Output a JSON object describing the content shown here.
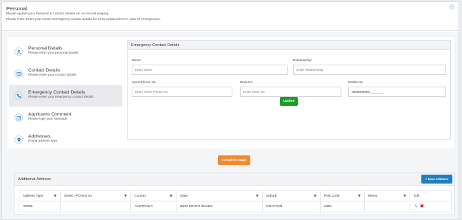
{
  "header": {
    "title": "Personal",
    "line1": "Please update your Personal & Contact Details for our record keeping.",
    "line2": "Please Note: Enter your correct Emergency contact details for us to contact them in case of emergencies."
  },
  "nav": {
    "items": [
      {
        "label": "Personal Details",
        "sub": "Please enter your personal details",
        "icon": "user-icon"
      },
      {
        "label": "Contact Details",
        "sub": "Please enter your contact details",
        "icon": "id-card-icon"
      },
      {
        "label": "Emergency Contact Details",
        "sub": "Please enter your emergency contact details",
        "icon": "phone-icon"
      },
      {
        "label": "Applicants Comment",
        "sub": "Please type your message",
        "icon": "edit-icon"
      },
      {
        "label": "Addresses",
        "sub": "Postal address type",
        "icon": "location-pin-icon"
      }
    ],
    "active_index": 2
  },
  "form": {
    "title": "Emergency Contact Details",
    "name_label": "Name",
    "name_placeholder": "Enter Name",
    "relationship_label": "Relationship",
    "relationship_placeholder": "Enter Relationship",
    "required_mark": "*",
    "home_phone_label": "Home Phone No",
    "home_phone_placeholder": "Enter Home Phone No",
    "work_no_label": "Work No",
    "work_no_placeholder": "Enter Work No",
    "mobile_label": "Mobile No",
    "mobile_value": "0000000000________",
    "update_label": "Update"
  },
  "complete_stage_label": "Complete Stage",
  "additional_address": {
    "title": "Additional Address",
    "new_button_label": "+ New Address",
    "columns": [
      "Address Type",
      "Street / PO Box no",
      "Country",
      "State",
      "Suburb",
      "Post Code",
      "Memo",
      "Edit"
    ],
    "rows": [
      {
        "address_type": "HOME",
        "street": "",
        "country": "AUSTRALIA",
        "state": "NEW SOUTH WALES",
        "suburb": "GRAFTON",
        "post_code": "2460",
        "memo": ""
      }
    ]
  },
  "colors": {
    "update_green": "#1e9d24",
    "complete_orange": "#f28a2d",
    "new_address_blue": "#1f7fc3",
    "delete_red": "#d91c1c"
  }
}
